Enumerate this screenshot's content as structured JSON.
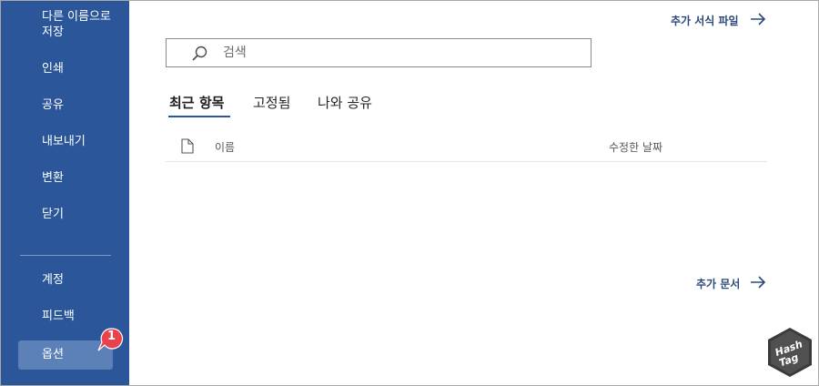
{
  "sidebar": {
    "items": [
      {
        "label": "다른 이름으로 저장"
      },
      {
        "label": "인쇄"
      },
      {
        "label": "공유"
      },
      {
        "label": "내보내기"
      },
      {
        "label": "변환"
      },
      {
        "label": "닫기"
      },
      {
        "label": "계정"
      },
      {
        "label": "피드백"
      },
      {
        "label": "옵션"
      }
    ],
    "selected": "옵션",
    "badge": "1"
  },
  "main": {
    "more_templates": "추가 서식 파일",
    "search": {
      "placeholder": "검색",
      "value": ""
    },
    "tabs": [
      {
        "label": "최근 항목",
        "active": true
      },
      {
        "label": "고정됨",
        "active": false
      },
      {
        "label": "나와 공유",
        "active": false
      }
    ],
    "columns": {
      "name": "이름",
      "modified": "수정한 날짜"
    },
    "more_documents": "추가 문서"
  },
  "logo": {
    "line1": "Hash",
    "line2": "Tag"
  },
  "colors": {
    "sidebar": "#2b579a",
    "selected": "#5b81b8",
    "badge": "#e8434d",
    "link": "#2b4a7a"
  }
}
